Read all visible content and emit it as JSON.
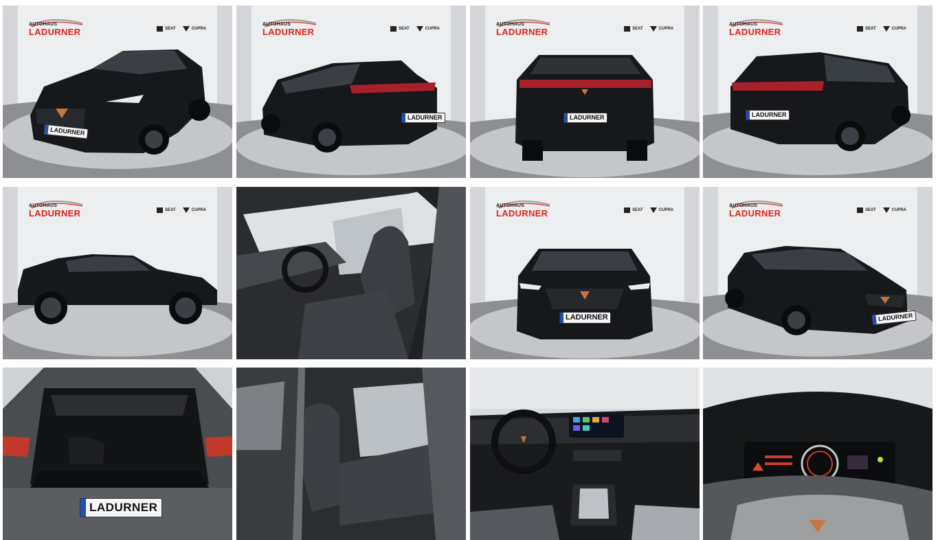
{
  "gallery": {
    "dealer_logo_top": "AUTOHAUS",
    "dealer_logo_main": "LADURNER",
    "brand_seat": "SEAT",
    "brand_cupra": "CUPRA",
    "plate_text": "LADURNER",
    "photos": [
      {
        "view": "front-left"
      },
      {
        "view": "rear-left"
      },
      {
        "view": "rear"
      },
      {
        "view": "rear-right"
      },
      {
        "view": "side-left"
      },
      {
        "view": "front-seats-interior"
      },
      {
        "view": "front"
      },
      {
        "view": "front-right"
      },
      {
        "view": "trunk"
      },
      {
        "view": "rear-seats-interior"
      },
      {
        "view": "dashboard"
      },
      {
        "view": "instrument-cluster"
      }
    ]
  },
  "colors": {
    "studio_wall": "#eceef0",
    "studio_floor": "#b9bbbe",
    "car_body": "#16181b",
    "logo_red": "#e2231a",
    "accent_copper": "#c8743c"
  }
}
